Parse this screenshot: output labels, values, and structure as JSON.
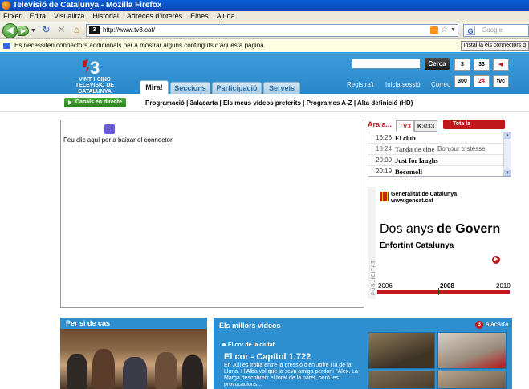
{
  "browser": {
    "title": "Televisió de Catalunya - Mozilla Firefox",
    "menu": [
      "Fitxer",
      "Edita",
      "Visualitza",
      "Historial",
      "Adreces d'interès",
      "Eines",
      "Ajuda"
    ],
    "url": "http://www.tv3.cat/",
    "url_favicon": "3",
    "search_placeholder": "Google",
    "search_engine_icon": "G",
    "notification": "Es necessiten connectors addicionals per a mostrar alguns continguts d'aquesta pàgina.",
    "install_button": "Instal·la els connectors q"
  },
  "site": {
    "logo_lines": [
      "VINT·I·CINC",
      "TELEVISIÓ DE CATALUNYA"
    ],
    "search_button": "Cerca",
    "channels_row1": [
      "3",
      "33",
      "◀"
    ],
    "channels_row2": [
      "300",
      "24",
      "tvc"
    ],
    "tabs": [
      "Mira!",
      "Seccions",
      "Participació",
      "Serveis"
    ],
    "top_links": [
      "Registra't",
      "Inicia sessió",
      "Correu"
    ],
    "live_button": "Canals en directe",
    "subnav": "Programació | 3alacarta | Els meus vídeos preferits | Programes A-Z | Alta definició (HD)"
  },
  "plugin": {
    "message": "Feu clic aquí per a baixar el connector."
  },
  "guide": {
    "now_label": "Ara a...",
    "channels": [
      "TV3",
      "K3/33"
    ],
    "all_button": "Tota la programació",
    "rows": [
      {
        "time": "16:26",
        "program": "El club",
        "subtitle": ""
      },
      {
        "time": "18:24",
        "program": "Tarda de cine",
        "subtitle": "Bonjour tristesse"
      },
      {
        "time": "20:00",
        "program": "Just for laughs",
        "subtitle": ""
      },
      {
        "time": "20:19",
        "program": "Bocamoll",
        "subtitle": ""
      }
    ]
  },
  "ad": {
    "side_label": "PUBLICITAT",
    "org": "Generalitat de Catalunya",
    "org_url": "www.gencat.cat",
    "headline_light": "Dos anys",
    "headline_bold": "de Govern",
    "subline": "Enfortint Catalunya",
    "years": [
      "2006",
      "2008",
      "2010"
    ]
  },
  "sections": {
    "per_si_de_cas": "Per si de cas",
    "videos_title": "Els millors vídeos",
    "alacarta_label": "alacarta",
    "video_kicker": "El cor de la ciutat",
    "video_title": "El cor - Capítol 1.722",
    "video_desc": "En Juli es troba entre la pressió d'en Jofre i la de la Lluna. I l'Alba vol que la seva amiga perdoni l'Àlex. La Marga descobreix el forat de la paret, però les provocacions..."
  },
  "colors": {
    "brand_blue": "#2e8fd0",
    "brand_red": "#c0171b",
    "live_green": "#2a7d1c"
  }
}
